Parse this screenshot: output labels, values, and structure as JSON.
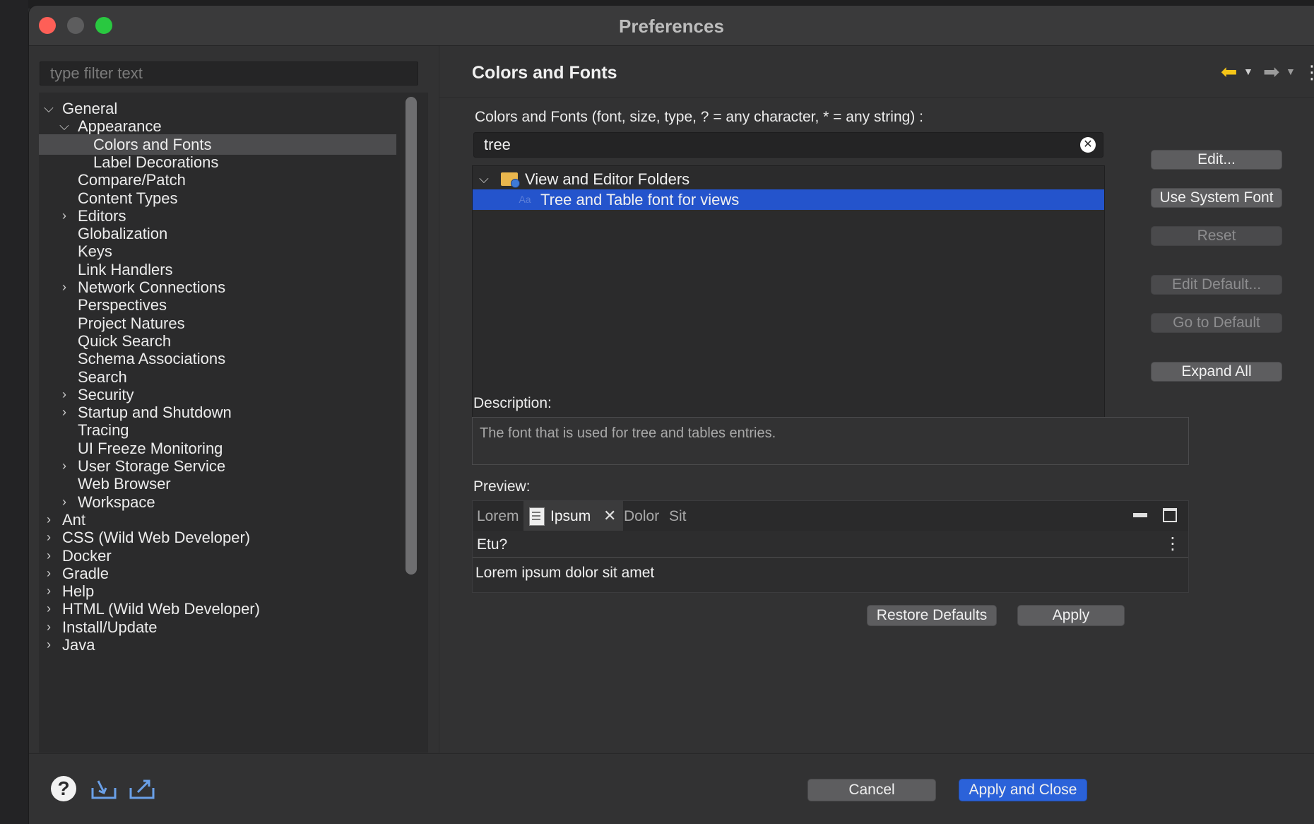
{
  "window": {
    "title": "Preferences"
  },
  "left": {
    "filter_placeholder": "type filter text",
    "tree": [
      {
        "label": "General",
        "depth": 0,
        "chevron": "expanded"
      },
      {
        "label": "Appearance",
        "depth": 1,
        "chevron": "expanded"
      },
      {
        "label": "Colors and Fonts",
        "depth": 2,
        "chevron": "none",
        "selected": true
      },
      {
        "label": "Label Decorations",
        "depth": 2,
        "chevron": "none"
      },
      {
        "label": "Compare/Patch",
        "depth": 1,
        "chevron": "none"
      },
      {
        "label": "Content Types",
        "depth": 1,
        "chevron": "none"
      },
      {
        "label": "Editors",
        "depth": 1,
        "chevron": "collapsed"
      },
      {
        "label": "Globalization",
        "depth": 1,
        "chevron": "none"
      },
      {
        "label": "Keys",
        "depth": 1,
        "chevron": "none"
      },
      {
        "label": "Link Handlers",
        "depth": 1,
        "chevron": "none"
      },
      {
        "label": "Network Connections",
        "depth": 1,
        "chevron": "collapsed"
      },
      {
        "label": "Perspectives",
        "depth": 1,
        "chevron": "none"
      },
      {
        "label": "Project Natures",
        "depth": 1,
        "chevron": "none"
      },
      {
        "label": "Quick Search",
        "depth": 1,
        "chevron": "none"
      },
      {
        "label": "Schema Associations",
        "depth": 1,
        "chevron": "none"
      },
      {
        "label": "Search",
        "depth": 1,
        "chevron": "none"
      },
      {
        "label": "Security",
        "depth": 1,
        "chevron": "collapsed"
      },
      {
        "label": "Startup and Shutdown",
        "depth": 1,
        "chevron": "collapsed"
      },
      {
        "label": "Tracing",
        "depth": 1,
        "chevron": "none"
      },
      {
        "label": "UI Freeze Monitoring",
        "depth": 1,
        "chevron": "none"
      },
      {
        "label": "User Storage Service",
        "depth": 1,
        "chevron": "collapsed"
      },
      {
        "label": "Web Browser",
        "depth": 1,
        "chevron": "none"
      },
      {
        "label": "Workspace",
        "depth": 1,
        "chevron": "collapsed"
      },
      {
        "label": "Ant",
        "depth": 0,
        "chevron": "collapsed"
      },
      {
        "label": "CSS (Wild Web Developer)",
        "depth": 0,
        "chevron": "collapsed"
      },
      {
        "label": "Docker",
        "depth": 0,
        "chevron": "collapsed"
      },
      {
        "label": "Gradle",
        "depth": 0,
        "chevron": "collapsed"
      },
      {
        "label": "Help",
        "depth": 0,
        "chevron": "collapsed"
      },
      {
        "label": "HTML (Wild Web Developer)",
        "depth": 0,
        "chevron": "collapsed"
      },
      {
        "label": "Install/Update",
        "depth": 0,
        "chevron": "collapsed"
      },
      {
        "label": "Java",
        "depth": 0,
        "chevron": "collapsed"
      }
    ]
  },
  "right": {
    "title": "Colors and Fonts",
    "instructions": "Colors and Fonts (font, size, type, ? = any character, * = any string) :",
    "search_value": "tree",
    "font_tree": [
      {
        "label": "View and Editor Folders",
        "type": "category"
      },
      {
        "label": "Tree and Table font for views",
        "type": "font",
        "selected": true
      }
    ],
    "buttons": [
      {
        "label": "Edit...",
        "enabled": true
      },
      {
        "label": "Use System Font",
        "enabled": true
      },
      {
        "label": "Reset",
        "enabled": false
      },
      {
        "label": "Edit Default...",
        "enabled": false
      },
      {
        "label": "Go to Default",
        "enabled": false
      },
      {
        "label": "Expand All",
        "enabled": true
      }
    ],
    "description_label": "Description:",
    "description_text": "The font that is used for tree and tables entries.",
    "preview_label": "Preview:",
    "preview": {
      "tabs": [
        {
          "label": "Lorem",
          "active": false
        },
        {
          "label": "Ipsum",
          "active": true
        },
        {
          "label": "Dolor",
          "active": false
        },
        {
          "label": "Sit",
          "active": false
        }
      ],
      "line1": "Etu?",
      "line2": "Lorem ipsum dolor sit amet"
    },
    "restore_defaults": "Restore Defaults",
    "apply": "Apply"
  },
  "footer": {
    "cancel": "Cancel",
    "apply_close": "Apply and Close"
  },
  "colors": {
    "selection": "#2454cc",
    "primary_button": "#2b62d9",
    "nav_back": "#f5c518"
  }
}
